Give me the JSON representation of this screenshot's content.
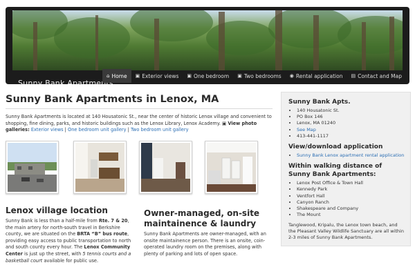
{
  "site": {
    "name": "Sunny Bank Apartments"
  },
  "nav": [
    {
      "label": "Home",
      "icon": "home-icon",
      "glyph": "⌂",
      "active": true
    },
    {
      "label": "Exterior views",
      "icon": "camera-icon",
      "glyph": "▣",
      "active": false
    },
    {
      "label": "One bedroom",
      "icon": "camera-icon",
      "glyph": "▣",
      "active": false
    },
    {
      "label": "Two bedrooms",
      "icon": "camera-icon",
      "glyph": "▣",
      "active": false
    },
    {
      "label": "Rental application",
      "icon": "info-icon",
      "glyph": "◉",
      "active": false
    },
    {
      "label": "Contact and Map",
      "icon": "contact-icon",
      "glyph": "▤",
      "active": false
    }
  ],
  "main": {
    "title": "Sunny Bank Apartments in Lenox, MA",
    "intro": {
      "text": "Sunny Bank Apartments is located at 140 Housatonic St., near the center of historic Lenox village and convenient to shopping, fine dining, parks, and historic buildings such as the Lenox Library, Lenox Academy.",
      "gallery_icon": "▣",
      "gallery_label": "View photo galleries:",
      "links": [
        "Exterior views",
        "One bedroom unit gallery",
        "Two bedroom unit gallery"
      ],
      "separator": "|"
    },
    "photos": [
      {
        "name": "photo-exterior",
        "alt": "Exterior view"
      },
      {
        "name": "photo-one-bedroom-kitchen",
        "alt": "One bedroom kitchen"
      },
      {
        "name": "photo-two-bedroom-room",
        "alt": "Two bedroom room"
      },
      {
        "name": "photo-laundry",
        "alt": "Laundry room"
      }
    ],
    "location": {
      "heading": "Lenox village location",
      "t1": "Sunny Bank is less than a half-mile from ",
      "b1": "Rte. 7 & 20",
      "t2": ", the main artery for north-south travel in Berkshire county, we are situated on the ",
      "b2": "BRTA “B” bus route",
      "t3": ", providing easy access to public transportation to north and south county every hour. The ",
      "b3": "Lenox Community Center",
      "t4": " is just up the street, with ",
      "i1": "5 tennis courts and a basketball court",
      "t5": " available for public use."
    },
    "owner": {
      "heading": "Owner-managed, on-site maintainence & laundry",
      "text": "Sunny Bank Apartments are owner-managed, with an onsite maintainence person. There is an onsite, coin-operated laundry room on the premises, along with plenty of parking and lots of open space."
    }
  },
  "sidebar": {
    "contact": {
      "heading": "Sunny Bank Apts.",
      "lines": [
        "140 Housatonic St.",
        "PO Box 146",
        "Lenox, MA 01240"
      ],
      "map_link": "See Map",
      "phone": "413-441-1117"
    },
    "apply": {
      "heading": "View/download application",
      "link": "Sunny Bank Lenox apartment rental application"
    },
    "walking": {
      "heading": "Within walking distance of Sunny Bank Apartments:",
      "items": [
        "Lenox Post Office & Town Hall",
        "Kennedy Park",
        "Ventfort Hall",
        "Canyon Ranch",
        "Shakespeare and Company",
        "The Mount"
      ],
      "footer": "Tanglewood, Kripalu, the Lenox town beach, and the Pleasant Valley Wildlife Sanctuary are all within 2-3 miles of Sunny Bank Apartments."
    }
  }
}
